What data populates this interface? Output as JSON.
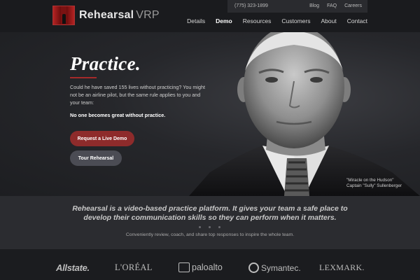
{
  "header": {
    "brand": "Rehearsal",
    "brand_suffix": "VRP",
    "phone": "(775) 323-1899",
    "utility_links": [
      "Blog",
      "FAQ",
      "Careers"
    ],
    "nav": [
      "Details",
      "Demo",
      "Resources",
      "Customers",
      "About",
      "Contact"
    ],
    "active_nav": "Demo"
  },
  "hero": {
    "title": "Practice.",
    "body": "Could he have saved 155 lives without practicing? You might not be an airline pilot, but the same rule applies to you and your team:",
    "strong": "No one becomes great without practice.",
    "cta_primary": "Request a Live Demo",
    "cta_secondary": "Tour Rehearsal",
    "caption_line1": "\"Miracle on the Hudson\"",
    "caption_line2": "Captain \"Sully\" Sullenberger"
  },
  "band": {
    "tagline": "Rehearsal is a video-based practice platform. It gives your team a safe place to develop their communication skills so they can perform when it matters.",
    "subline": "Conveniently review, coach, and share top responses to inspire the whole team."
  },
  "clients": {
    "allstate": "Allstate.",
    "loreal": "L'ORÉAL",
    "paloalto": "paloalto",
    "symantec": "Symantec.",
    "lexmark": "LEXMARK."
  },
  "colors": {
    "accent": "#8e2b2b",
    "background": "#1c1d20"
  }
}
